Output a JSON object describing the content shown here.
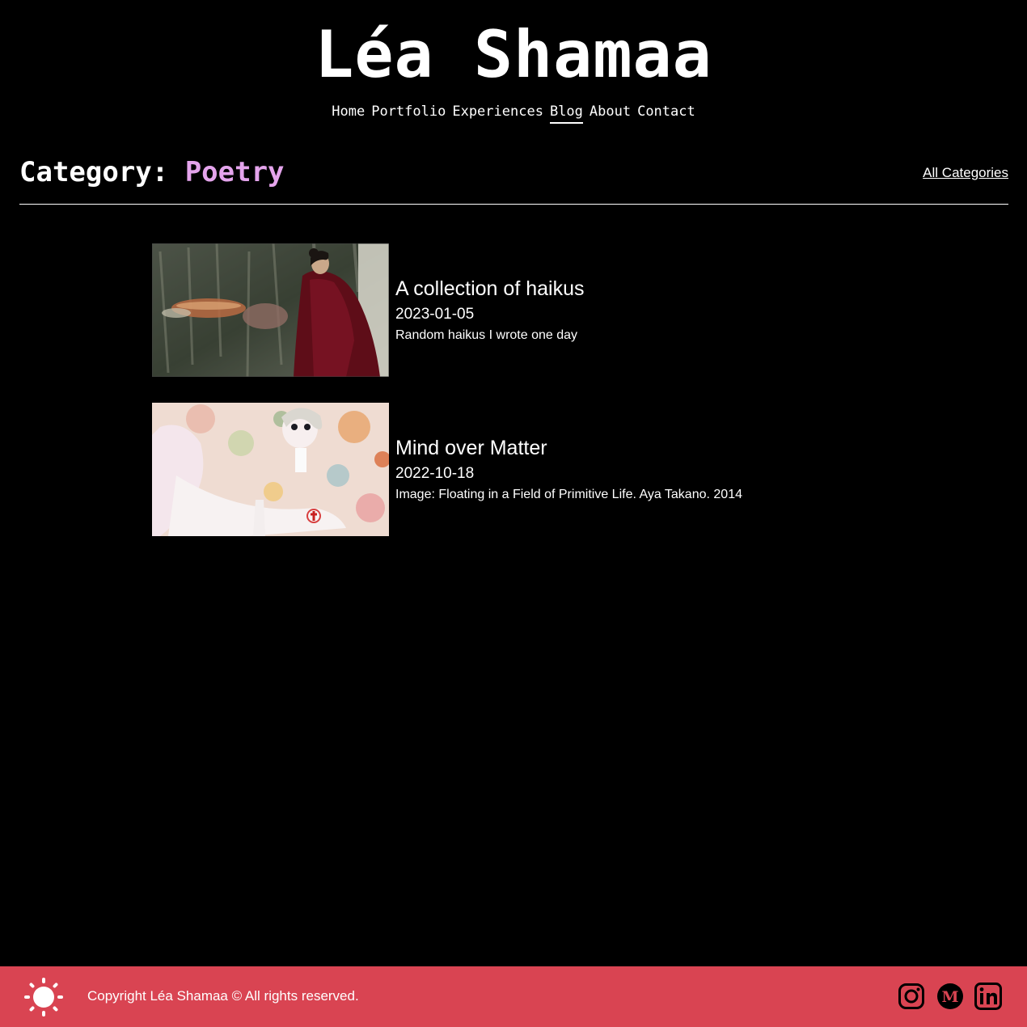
{
  "site": {
    "title": "Léa Shamaa"
  },
  "nav": {
    "items": [
      {
        "label": "Home"
      },
      {
        "label": "Portfolio"
      },
      {
        "label": "Experiences"
      },
      {
        "label": "Blog"
      },
      {
        "label": "About"
      },
      {
        "label": "Contact"
      }
    ],
    "active": "Blog"
  },
  "category": {
    "prefix": "Category: ",
    "name": "Poetry",
    "all_link": "All Categories"
  },
  "posts": [
    {
      "title": "A collection of haikus",
      "date": "2023-01-05",
      "summary": "Random haikus I wrote one day",
      "thumbnail": "painting-woman-red-cloak-icon"
    },
    {
      "title": "Mind over Matter",
      "date": "2022-10-18",
      "summary": "Image: Floating in a Field of Primitive Life. Aya Takano. 2014",
      "thumbnail": "floral-painting-figure-icon"
    }
  ],
  "footer": {
    "copyright": "Copyright Léa Shamaa © All rights reserved.",
    "theme_icon": "sun-icon",
    "social": [
      "instagram-icon",
      "medium-icon",
      "linkedin-icon"
    ]
  },
  "colors": {
    "background": "#000000",
    "text": "#ffffff",
    "accent_category": "#e4a4ec",
    "footer": "#d94452"
  }
}
